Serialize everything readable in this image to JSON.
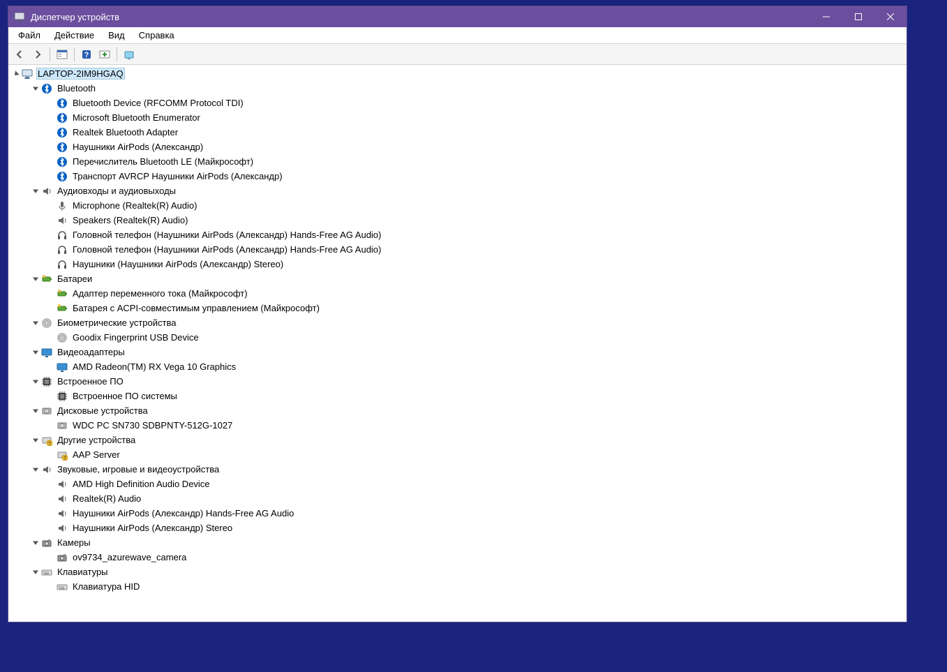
{
  "window": {
    "title": "Диспетчер устройств"
  },
  "menubar": {
    "file": "Файл",
    "action": "Действие",
    "view": "Вид",
    "help": "Справка"
  },
  "tree": {
    "root": "LAPTOP-2IM9HGAQ",
    "categories": [
      {
        "name": "Bluetooth",
        "icon": "bluetooth",
        "children": [
          "Bluetooth Device (RFCOMM Protocol TDI)",
          "Microsoft Bluetooth Enumerator",
          "Realtek Bluetooth Adapter",
          "Наушники AirPods (Александр)",
          "Перечислитель Bluetooth LE (Майкрософт)",
          "Транспорт AVRCP Наушники AirPods (Александр)"
        ]
      },
      {
        "name": "Аудиовходы и аудиовыходы",
        "icon": "speaker",
        "children": [
          "Microphone (Realtek(R) Audio)",
          "Speakers (Realtek(R) Audio)",
          "Головной телефон (Наушники AirPods (Александр) Hands-Free AG Audio)",
          "Головной телефон (Наушники AirPods (Александр) Hands-Free AG Audio)",
          "Наушники (Наушники AirPods (Александр) Stereo)"
        ],
        "child_icons": [
          "mic",
          "speaker",
          "headset",
          "headset",
          "headset"
        ]
      },
      {
        "name": "Батареи",
        "icon": "battery",
        "children": [
          "Адаптер переменного тока (Майкрософт)",
          "Батарея с ACPI-совместимым управлением (Майкрософт)"
        ]
      },
      {
        "name": "Биометрические устройства",
        "icon": "fingerprint",
        "children": [
          "Goodix Fingerprint USB Device"
        ]
      },
      {
        "name": "Видеоадаптеры",
        "icon": "display",
        "children": [
          "AMD Radeon(TM) RX Vega 10 Graphics"
        ]
      },
      {
        "name": "Встроенное ПО",
        "icon": "chip",
        "children": [
          "Встроенное ПО системы"
        ]
      },
      {
        "name": "Дисковые устройства",
        "icon": "disk",
        "children": [
          "WDC PC SN730 SDBPNTY-512G-1027"
        ]
      },
      {
        "name": "Другие устройства",
        "icon": "unknown",
        "children": [
          "AAP Server"
        ]
      },
      {
        "name": "Звуковые, игровые и видеоустройства",
        "icon": "speaker",
        "children": [
          "AMD High Definition Audio Device",
          "Realtek(R) Audio",
          "Наушники AirPods (Александр) Hands-Free AG Audio",
          "Наушники AirPods (Александр) Stereo"
        ]
      },
      {
        "name": "Камеры",
        "icon": "camera",
        "children": [
          "ov9734_azurewave_camera"
        ]
      },
      {
        "name": "Клавиатуры",
        "icon": "keyboard",
        "children": [
          "Клавиатура HID"
        ]
      }
    ]
  }
}
